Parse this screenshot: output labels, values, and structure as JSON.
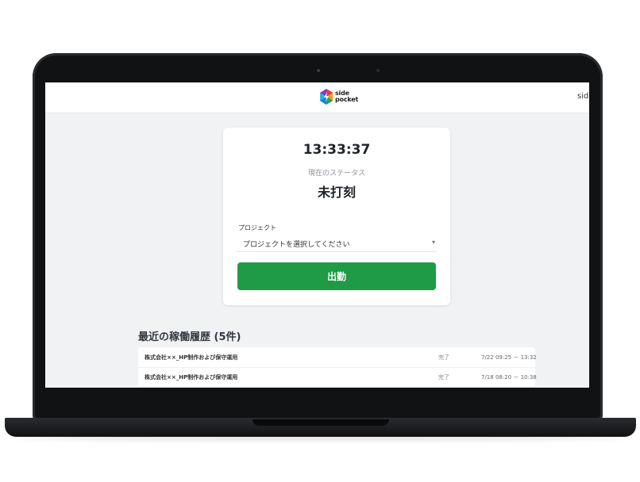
{
  "header": {
    "logo_line1": "side",
    "logo_line2": "pocket",
    "user_link": "side"
  },
  "punch_card": {
    "clock": "13:33:37",
    "status_label": "現在のステータス",
    "status_value": "未打刻",
    "project_label": "プロジェクト",
    "project_select_value": "プロジェクトを選択してください",
    "clock_in_button": "出勤"
  },
  "history": {
    "title": "最近の稼働履歴 (5件)",
    "rows": [
      {
        "project": "株式会社××_HP制作および保守運用",
        "status": "完了",
        "time": "7/22 09:25 － 13:32"
      },
      {
        "project": "株式会社××_HP制作および保守運用",
        "status": "完了",
        "time": "7/18 08:20 － 10:38"
      }
    ]
  },
  "colors": {
    "accent_green": "#1f9a45",
    "page_background": "#f1f2f4"
  }
}
